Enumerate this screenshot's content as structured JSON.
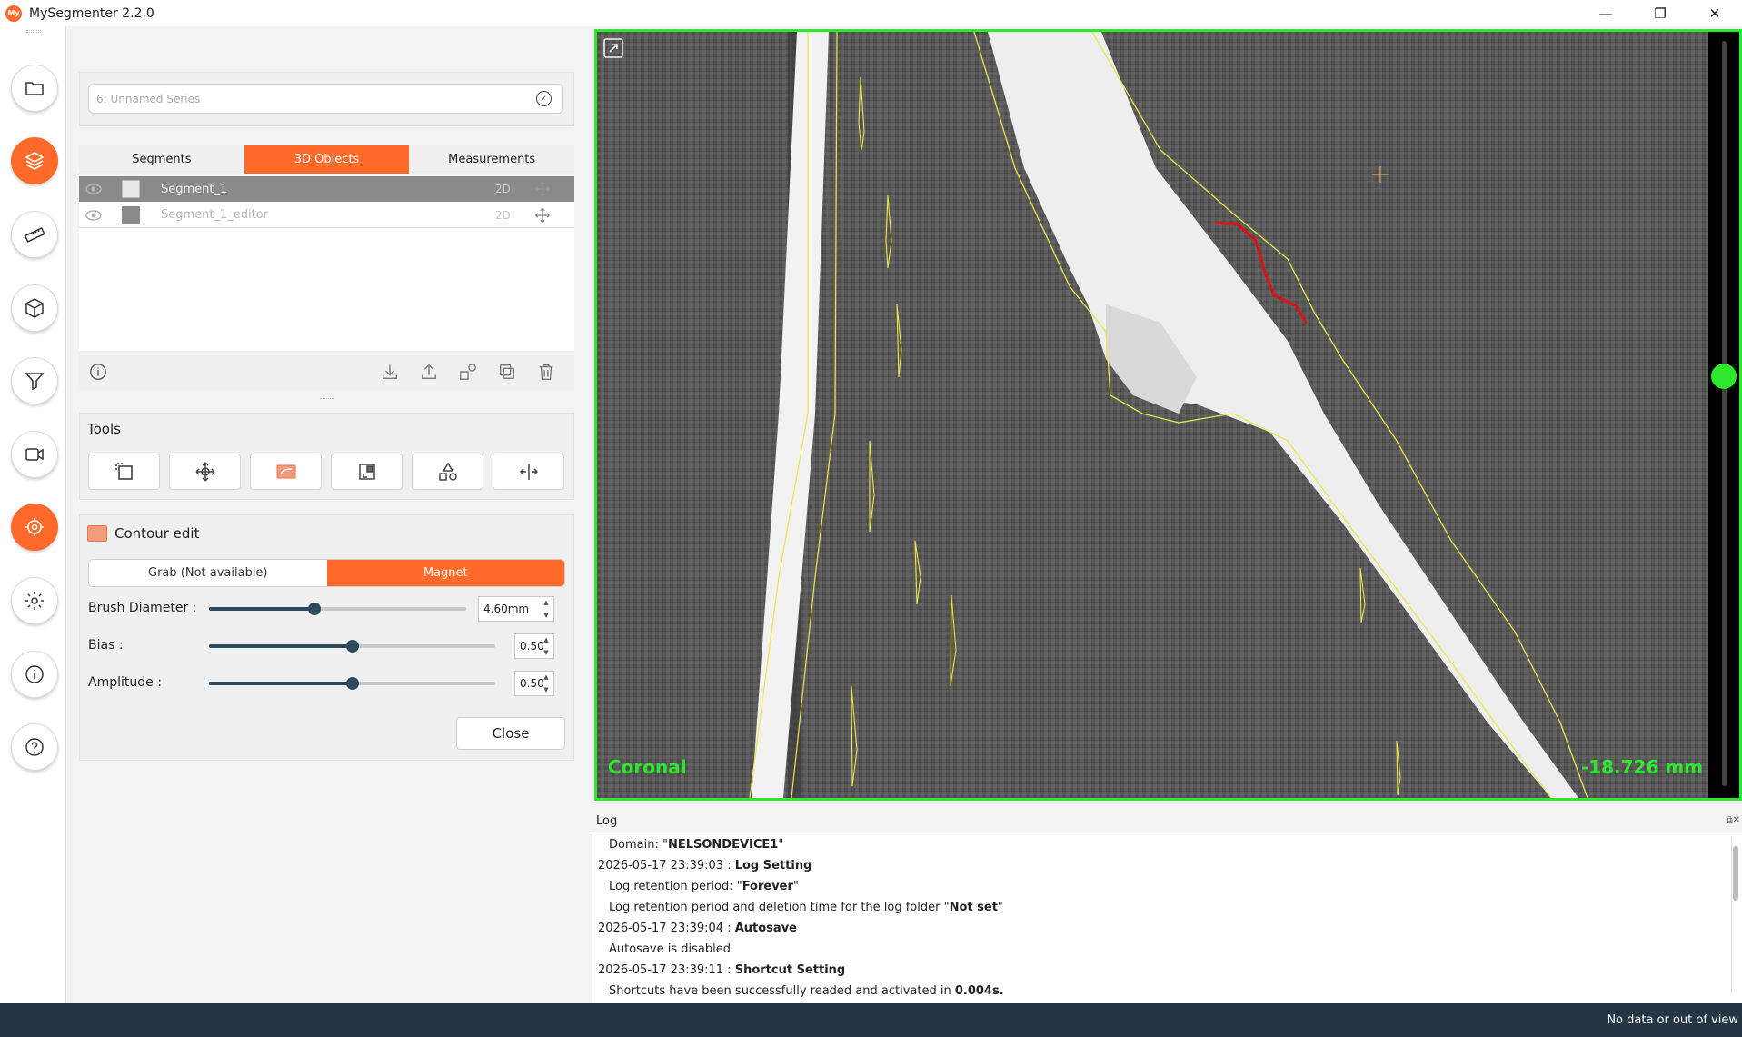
{
  "app": {
    "logo_text": "My",
    "title": "MySegmenter 2.2.0"
  },
  "window": {
    "minimize": "—",
    "restore": "❐",
    "close": "✕"
  },
  "rail": {
    "items": [
      "folder-icon",
      "layers-icon",
      "ruler-icon",
      "cube-icon",
      "filter-icon",
      "camera-icon",
      "target-icon",
      "settings-icon",
      "info-icon",
      "help-icon"
    ],
    "active": [
      "layers-icon",
      "target-icon"
    ]
  },
  "series": {
    "selected": "6: Unnamed Series"
  },
  "tabs": [
    {
      "label": "Segments",
      "active": false
    },
    {
      "label": "3D Objects",
      "active": true
    },
    {
      "label": "Measurements",
      "active": false
    }
  ],
  "segments": [
    {
      "name": "Segment_1",
      "dim": "2D",
      "selected": true
    },
    {
      "name": "Segment_1_editor",
      "dim": "2D",
      "selected": false
    }
  ],
  "tools": {
    "title": "Tools"
  },
  "contour_edit": {
    "title": "Contour edit",
    "modes": [
      "Grab (Not available)",
      "Magnet"
    ],
    "active_mode": "Magnet",
    "brush": {
      "label": "Brush Diameter :",
      "value": "4.60mm",
      "fraction": 0.41
    },
    "bias": {
      "label": "Bias :",
      "value": "0.50",
      "fraction": 0.5
    },
    "amplitude": {
      "label": "Amplitude :",
      "value": "0.50",
      "fraction": 0.5
    },
    "close_label": "Close"
  },
  "viewer": {
    "view_name": "Coronal",
    "position": "-18.726 mm",
    "slice_fraction": 0.45,
    "border_color": "#2ee82e"
  },
  "log": {
    "title": "Log",
    "lines": [
      {
        "indent": true,
        "pre": "Domain: \"",
        "bold": "NELSONDEVICE1",
        "post": "\""
      },
      {
        "indent": false,
        "pre": "2026-05-17 23:39:03 : ",
        "bold": "Log Setting",
        "post": ""
      },
      {
        "indent": true,
        "pre": "Log retention period: \"",
        "bold": "Forever",
        "post": "\""
      },
      {
        "indent": true,
        "pre": "Log retention period and deletion time for the log folder \"",
        "bold": "Not set",
        "post": "\""
      },
      {
        "indent": false,
        "pre": "2026-05-17 23:39:04 : ",
        "bold": "Autosave",
        "post": ""
      },
      {
        "indent": true,
        "pre": "Autosave is disabled",
        "bold": "",
        "post": ""
      },
      {
        "indent": false,
        "pre": "2026-05-17 23:39:11 : ",
        "bold": "Shortcut Setting",
        "post": ""
      },
      {
        "indent": true,
        "pre": "Shortcuts have been successfully readed and activated in ",
        "bold": "0.004s.",
        "post": ""
      }
    ]
  },
  "status": {
    "text": "No data or out of view"
  },
  "colors": {
    "accent": "#ff6a2b",
    "viewer_green": "#2ee82e",
    "status_bg": "#263545",
    "contour_yellow": "#e8e84a",
    "edit_red": "#e01010"
  }
}
